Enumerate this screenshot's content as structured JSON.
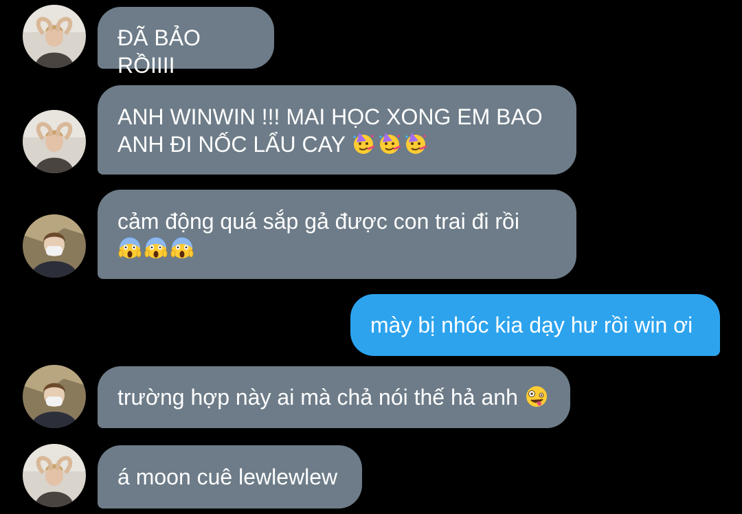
{
  "conversation": {
    "messages": [
      {
        "sender": "other",
        "avatar": "avatar-heart-pose",
        "text": "ĐÃ BẢO RỒIIII"
      },
      {
        "sender": "other",
        "avatar": "avatar-heart-pose",
        "text": "ANH WINWIN !!! MAI HỌC XONG EM BAO\nANH ĐI NỐC LẨU CAY",
        "emoji": [
          "partying-face-emoji",
          "partying-face-emoji",
          "partying-face-emoji"
        ]
      },
      {
        "sender": "other",
        "avatar": "avatar-masked-person",
        "text": "cảm động quá sắp gả được con trai đi rồi",
        "emoji": [
          "face-screaming-in-fear-emoji",
          "face-screaming-in-fear-emoji",
          "face-screaming-in-fear-emoji"
        ]
      },
      {
        "sender": "me",
        "text": "mày bị nhóc kia dạy hư rồi win ơi"
      },
      {
        "sender": "other",
        "avatar": "avatar-masked-person",
        "text": "trường hợp này ai mà chả nói thế hả anh",
        "emoji": [
          "zany-face-emoji"
        ]
      },
      {
        "sender": "other",
        "avatar": "avatar-heart-pose",
        "text": "á moon cuê lewlewlew"
      }
    ]
  },
  "colors": {
    "background": "#000000",
    "incoming_bubble": "#6d7c88",
    "outgoing_bubble": "#2da3ee",
    "text": "#ffffff"
  }
}
